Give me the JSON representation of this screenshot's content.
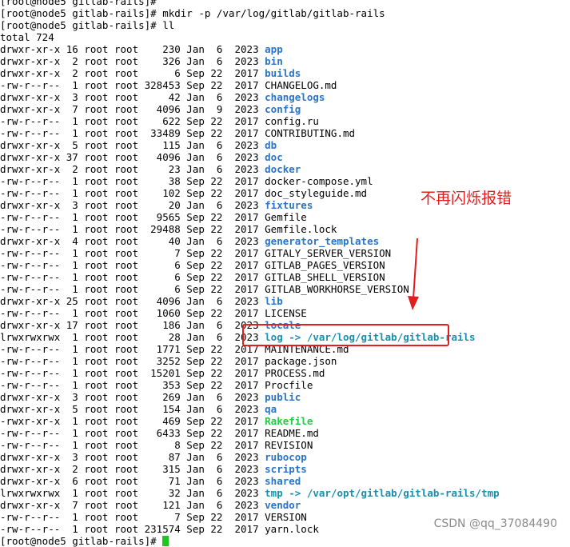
{
  "terminal": {
    "top_line": "[root@node5 gitlab-rails]#",
    "commands": [
      "[root@node5 gitlab-rails]# mkdir -p /var/log/gitlab/gitlab-rails",
      "[root@node5 gitlab-rails]# ll"
    ],
    "total": "total 724",
    "entries": [
      {
        "meta": "drwxr-xr-x 16 root root    230 Jan  6  2023 ",
        "name": "app",
        "type": "dir"
      },
      {
        "meta": "drwxr-xr-x  2 root root    326 Jan  6  2023 ",
        "name": "bin",
        "type": "dir"
      },
      {
        "meta": "drwxr-xr-x  2 root root      6 Sep 22  2017 ",
        "name": "builds",
        "type": "dir"
      },
      {
        "meta": "-rw-r--r--  1 root root 328453 Sep 22  2017 ",
        "name": "CHANGELOG.md",
        "type": "file"
      },
      {
        "meta": "drwxr-xr-x  3 root root     42 Jan  6  2023 ",
        "name": "changelogs",
        "type": "dir"
      },
      {
        "meta": "drwxr-xr-x  7 root root   4096 Jan  9  2023 ",
        "name": "config",
        "type": "dir"
      },
      {
        "meta": "-rw-r--r--  1 root root    622 Sep 22  2017 ",
        "name": "config.ru",
        "type": "file"
      },
      {
        "meta": "-rw-r--r--  1 root root  33489 Sep 22  2017 ",
        "name": "CONTRIBUTING.md",
        "type": "file"
      },
      {
        "meta": "drwxr-xr-x  5 root root    115 Jan  6  2023 ",
        "name": "db",
        "type": "dir"
      },
      {
        "meta": "drwxr-xr-x 37 root root   4096 Jan  6  2023 ",
        "name": "doc",
        "type": "dir"
      },
      {
        "meta": "drwxr-xr-x  2 root root     23 Jan  6  2023 ",
        "name": "docker",
        "type": "dir"
      },
      {
        "meta": "-rw-r--r--  1 root root     38 Sep 22  2017 ",
        "name": "docker-compose.yml",
        "type": "file"
      },
      {
        "meta": "-rw-r--r--  1 root root    102 Sep 22  2017 ",
        "name": "doc_styleguide.md",
        "type": "file"
      },
      {
        "meta": "drwxr-xr-x  3 root root     20 Jan  6  2023 ",
        "name": "fixtures",
        "type": "dir"
      },
      {
        "meta": "-rw-r--r--  1 root root   9565 Sep 22  2017 ",
        "name": "Gemfile",
        "type": "file"
      },
      {
        "meta": "-rw-r--r--  1 root root  29488 Sep 22  2017 ",
        "name": "Gemfile.lock",
        "type": "file"
      },
      {
        "meta": "drwxr-xr-x  4 root root     40 Jan  6  2023 ",
        "name": "generator_templates",
        "type": "dir"
      },
      {
        "meta": "-rw-r--r--  1 root root      7 Sep 22  2017 ",
        "name": "GITALY_SERVER_VERSION",
        "type": "file"
      },
      {
        "meta": "-rw-r--r--  1 root root      6 Sep 22  2017 ",
        "name": "GITLAB_PAGES_VERSION",
        "type": "file"
      },
      {
        "meta": "-rw-r--r--  1 root root      6 Sep 22  2017 ",
        "name": "GITLAB_SHELL_VERSION",
        "type": "file"
      },
      {
        "meta": "-rw-r--r--  1 root root      6 Sep 22  2017 ",
        "name": "GITLAB_WORKHORSE_VERSION",
        "type": "file"
      },
      {
        "meta": "drwxr-xr-x 25 root root   4096 Jan  6  2023 ",
        "name": "lib",
        "type": "dir"
      },
      {
        "meta": "-rw-r--r--  1 root root   1060 Sep 22  2017 ",
        "name": "LICENSE",
        "type": "file"
      },
      {
        "meta": "drwxr-xr-x 17 root root    186 Jan  6  2023 ",
        "name": "locale",
        "type": "dir"
      },
      {
        "meta": "lrwxrwxrwx  1 root root     28 Jan  6  2023 ",
        "name": "log",
        "type": "link",
        "target": "/var/log/gitlab/gitlab-rails"
      },
      {
        "meta": "-rw-r--r--  1 root root   1771 Sep 22  2017 ",
        "name": "MAINTENANCE.md",
        "type": "file"
      },
      {
        "meta": "-rw-r--r--  1 root root   3252 Sep 22  2017 ",
        "name": "package.json",
        "type": "file"
      },
      {
        "meta": "-rw-r--r--  1 root root  15201 Sep 22  2017 ",
        "name": "PROCESS.md",
        "type": "file"
      },
      {
        "meta": "-rw-r--r--  1 root root    353 Sep 22  2017 ",
        "name": "Procfile",
        "type": "file"
      },
      {
        "meta": "drwxr-xr-x  3 root root    269 Jan  6  2023 ",
        "name": "public",
        "type": "dir"
      },
      {
        "meta": "drwxr-xr-x  5 root root    154 Jan  6  2023 ",
        "name": "qa",
        "type": "dir"
      },
      {
        "meta": "-rwxr-xr-x  1 root root    469 Sep 22  2017 ",
        "name": "Rakefile",
        "type": "exec"
      },
      {
        "meta": "-rw-r--r--  1 root root   6433 Sep 22  2017 ",
        "name": "README.md",
        "type": "file"
      },
      {
        "meta": "-rw-r--r--  1 root root      8 Sep 22  2017 ",
        "name": "REVISION",
        "type": "file"
      },
      {
        "meta": "drwxr-xr-x  3 root root     87 Jan  6  2023 ",
        "name": "rubocop",
        "type": "dir"
      },
      {
        "meta": "drwxr-xr-x  2 root root    315 Jan  6  2023 ",
        "name": "scripts",
        "type": "dir"
      },
      {
        "meta": "drwxr-xr-x  6 root root     71 Jan  6  2023 ",
        "name": "shared",
        "type": "dir"
      },
      {
        "meta": "lrwxrwxrwx  1 root root     32 Jan  6  2023 ",
        "name": "tmp",
        "type": "link",
        "target": "/var/opt/gitlab/gitlab-rails/tmp"
      },
      {
        "meta": "drwxr-xr-x  7 root root    121 Jan  6  2023 ",
        "name": "vendor",
        "type": "dir"
      },
      {
        "meta": "-rw-r--r--  1 root root      7 Sep 22  2017 ",
        "name": "VERSION",
        "type": "file"
      },
      {
        "meta": "-rw-r--r--  1 root root 231574 Sep 22  2017 ",
        "name": "yarn.lock",
        "type": "file"
      }
    ],
    "prompt": "[root@node5 gitlab-rails]# ",
    "link_arrow": " -> "
  },
  "annotation": {
    "text": "不再闪烁报错",
    "color": "#e02020"
  },
  "watermark": "CSDN @qq_37084490",
  "colors": {
    "dir": "#2b74c7",
    "exec": "#27c93f",
    "link": "#1a8fb0",
    "cursor": "#21c521"
  }
}
